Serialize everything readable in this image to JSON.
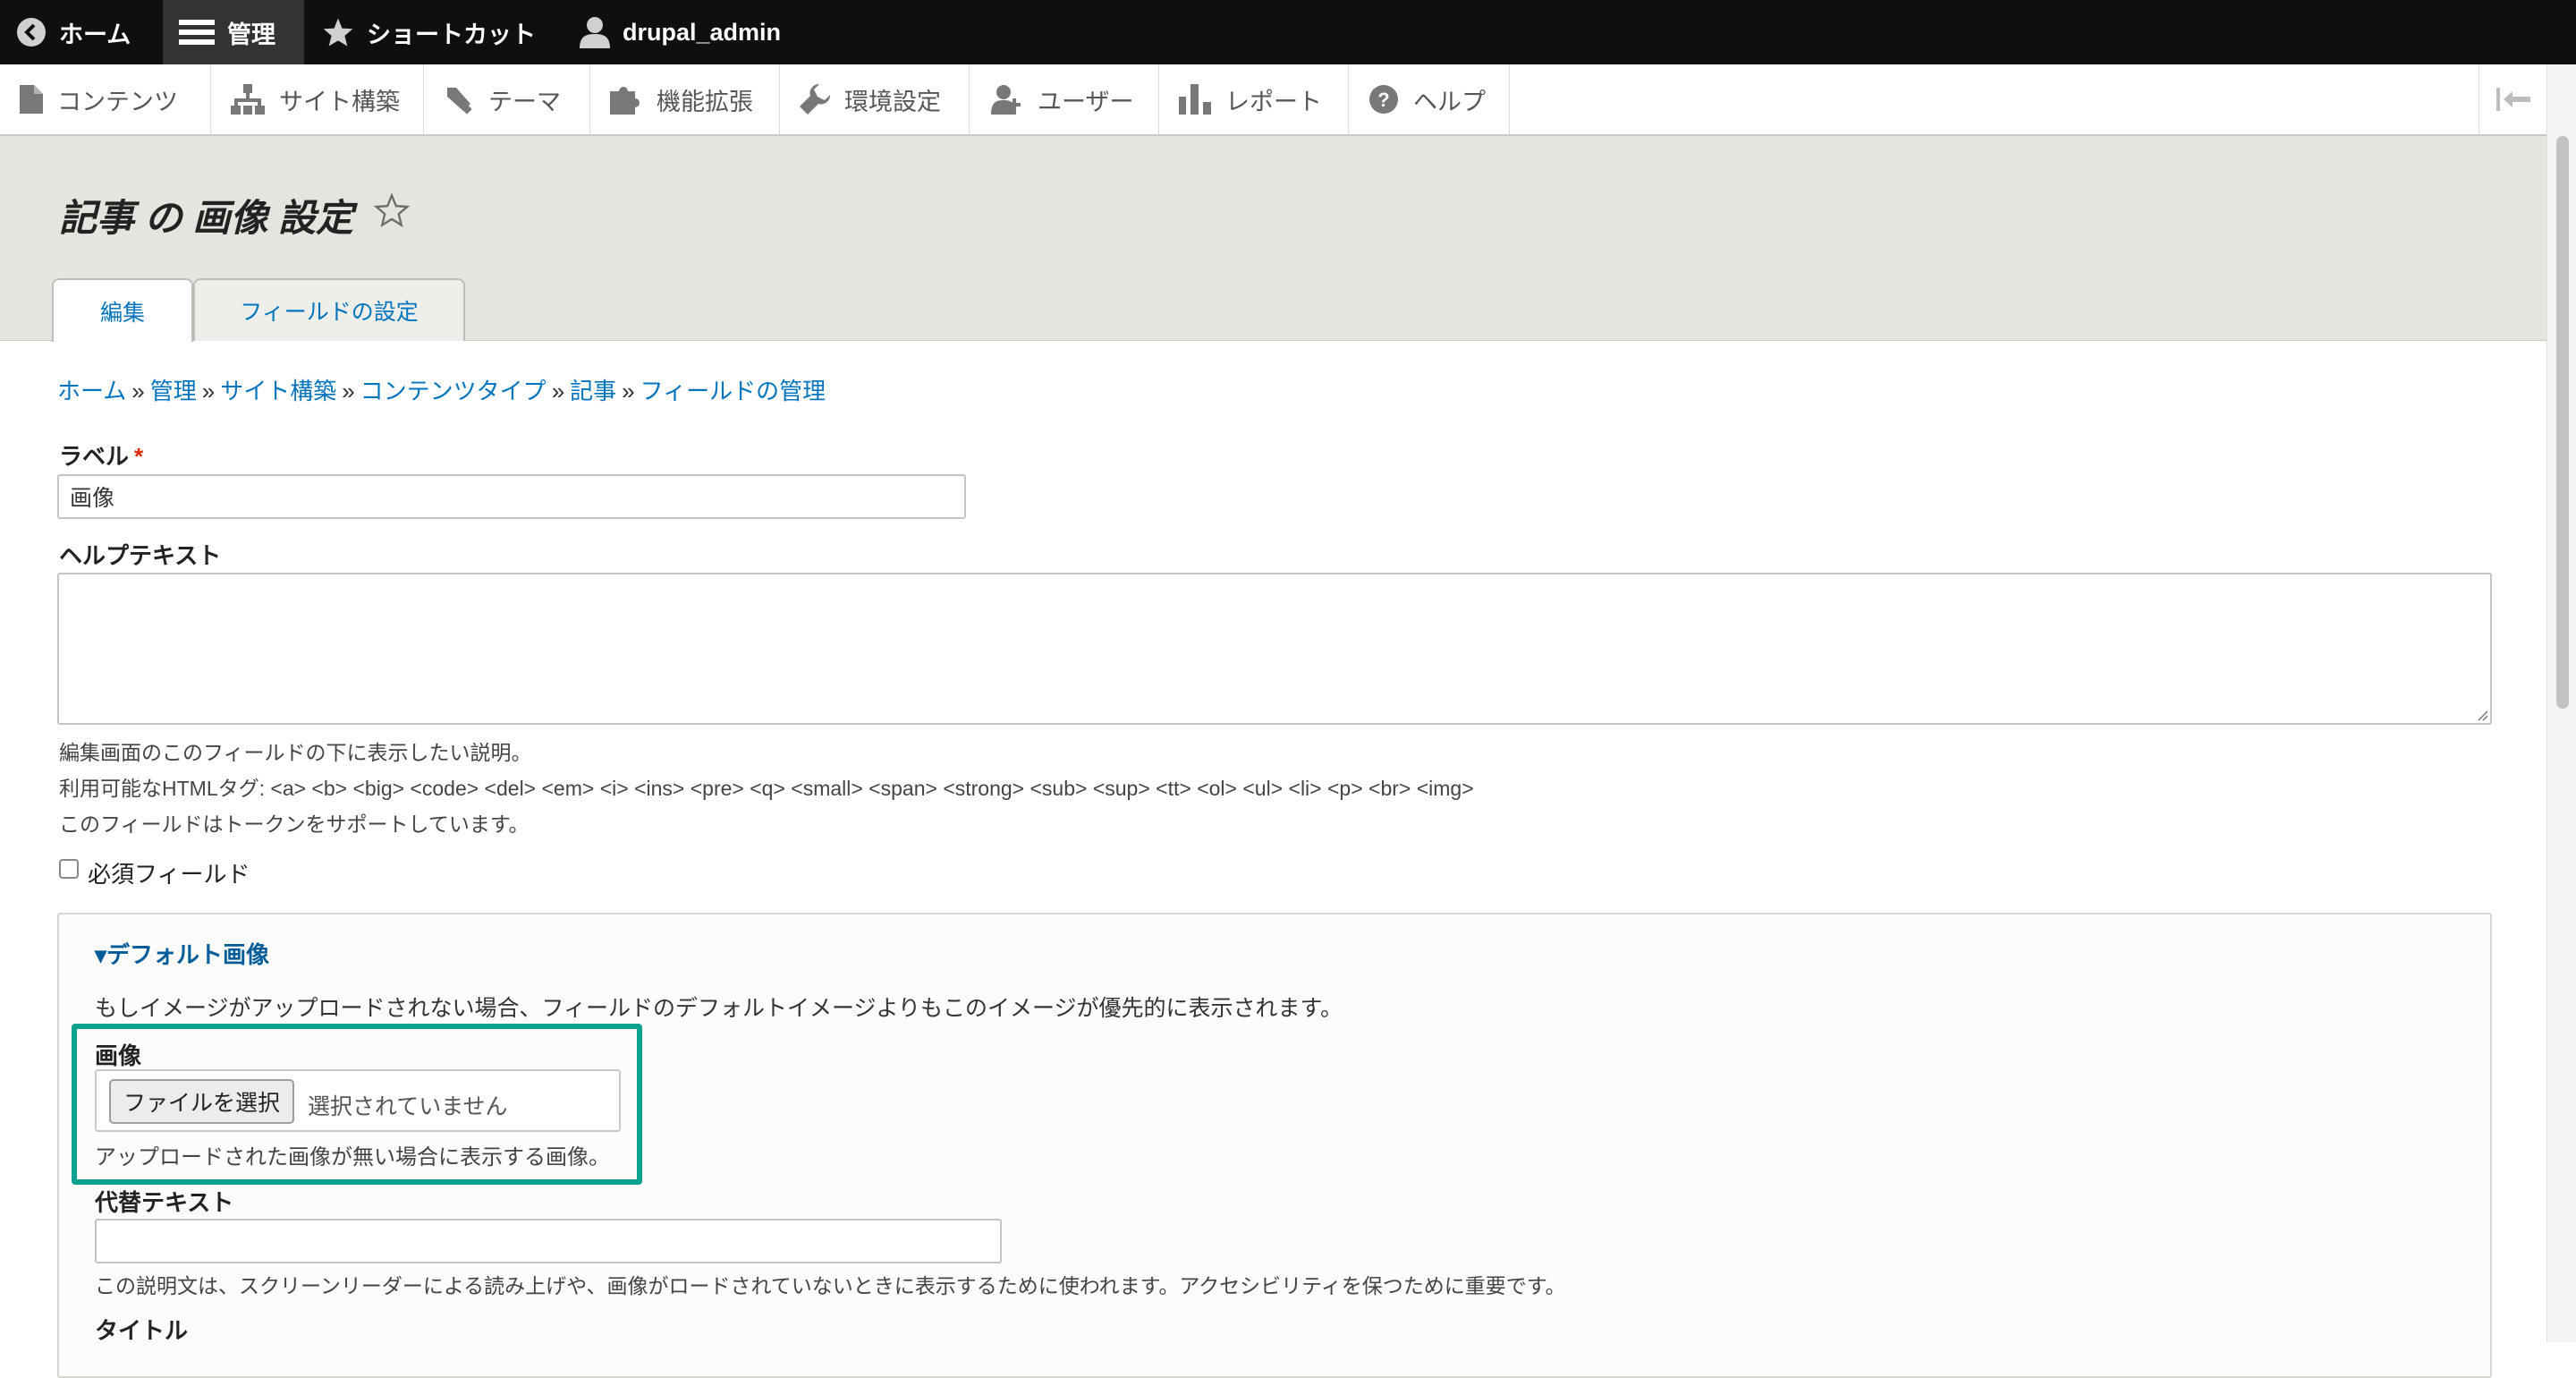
{
  "toolbar": {
    "home": "ホーム",
    "manage": "管理",
    "shortcuts": "ショートカット",
    "user": "drupal_admin"
  },
  "tray": {
    "items": [
      "コンテンツ",
      "サイト構築",
      "テーマ",
      "機能拡張",
      "環境設定",
      "ユーザー",
      "レポート",
      "ヘルプ"
    ]
  },
  "header": {
    "title": "記事 の 画像 設定",
    "tabs": [
      "編集",
      "フィールドの設定"
    ]
  },
  "breadcrumb": [
    "ホーム",
    "管理",
    "サイト構築",
    "コンテンツタイプ",
    "記事",
    "フィールドの管理"
  ],
  "breadcrumb_sep": "»",
  "form": {
    "label_title": "ラベル",
    "required_mark": "*",
    "label_value": "画像",
    "help_title": "ヘルプテキスト",
    "help_desc_1": "編集画面のこのフィールドの下に表示したい説明。",
    "help_desc_2": "利用可能なHTMLタグ: <a> <b> <big> <code> <del> <em> <i> <ins> <pre> <q> <small> <span> <strong> <sub> <sup> <tt> <ol> <ul> <li> <p> <br> <img>",
    "help_desc_3": "このフィールドはトークンをサポートしています。",
    "required_field_label": "必須フィールド",
    "required_field_checked": false
  },
  "default_image": {
    "summary": "▾デフォルト画像",
    "description": "もしイメージがアップロードされない場合、フィールドのデフォルトイメージよりもこのイメージが優先的に表示されます。",
    "image_label": "画像",
    "file_button": "ファイルを選択",
    "file_status": "選択されていません",
    "image_desc": "アップロードされた画像が無い場合に表示する画像。",
    "alt_label": "代替テキスト",
    "alt_value": "",
    "alt_desc": "この説明文は、スクリーンリーダーによる読み上げや、画像がロードされていないときに表示するために使われます。アクセシビリティを保つために重要です。",
    "title_label": "タイトル"
  },
  "colors": {
    "toolbar_bg": "#0f0f0f",
    "link": "#0074bd",
    "highlight": "#0ea08e",
    "required": "#e62600"
  }
}
